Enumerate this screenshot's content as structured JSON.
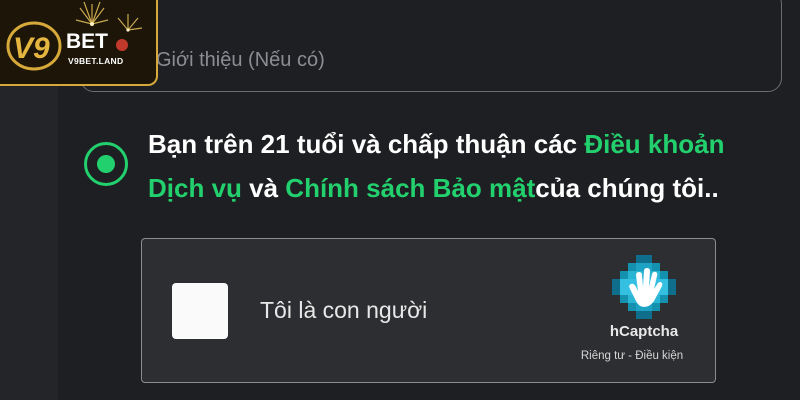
{
  "logo": {
    "brand_prefix": "V9",
    "brand_suffix": "BET",
    "domain": "V9BET.LAND",
    "accent_color": "#d6a93a"
  },
  "form": {
    "intro_placeholder": "Giới thiệu (Nếu có)",
    "terms": {
      "checked": true,
      "text_before": "Bạn trên 21 tuổi và chấp thuận các ",
      "link_terms": "Điều khoản Dịch vụ",
      "text_middle": " và ",
      "link_privacy": "Chính sách Bảo mật",
      "text_after": "của chúng tôi..",
      "accent_color": "#22d06e"
    }
  },
  "captcha": {
    "label": "Tôi là con người",
    "brand": "hCaptcha",
    "privacy_link": "Riêng tư",
    "separator": " - ",
    "terms_link": "Điều kiện",
    "icon": "hcaptcha-hand-icon"
  }
}
